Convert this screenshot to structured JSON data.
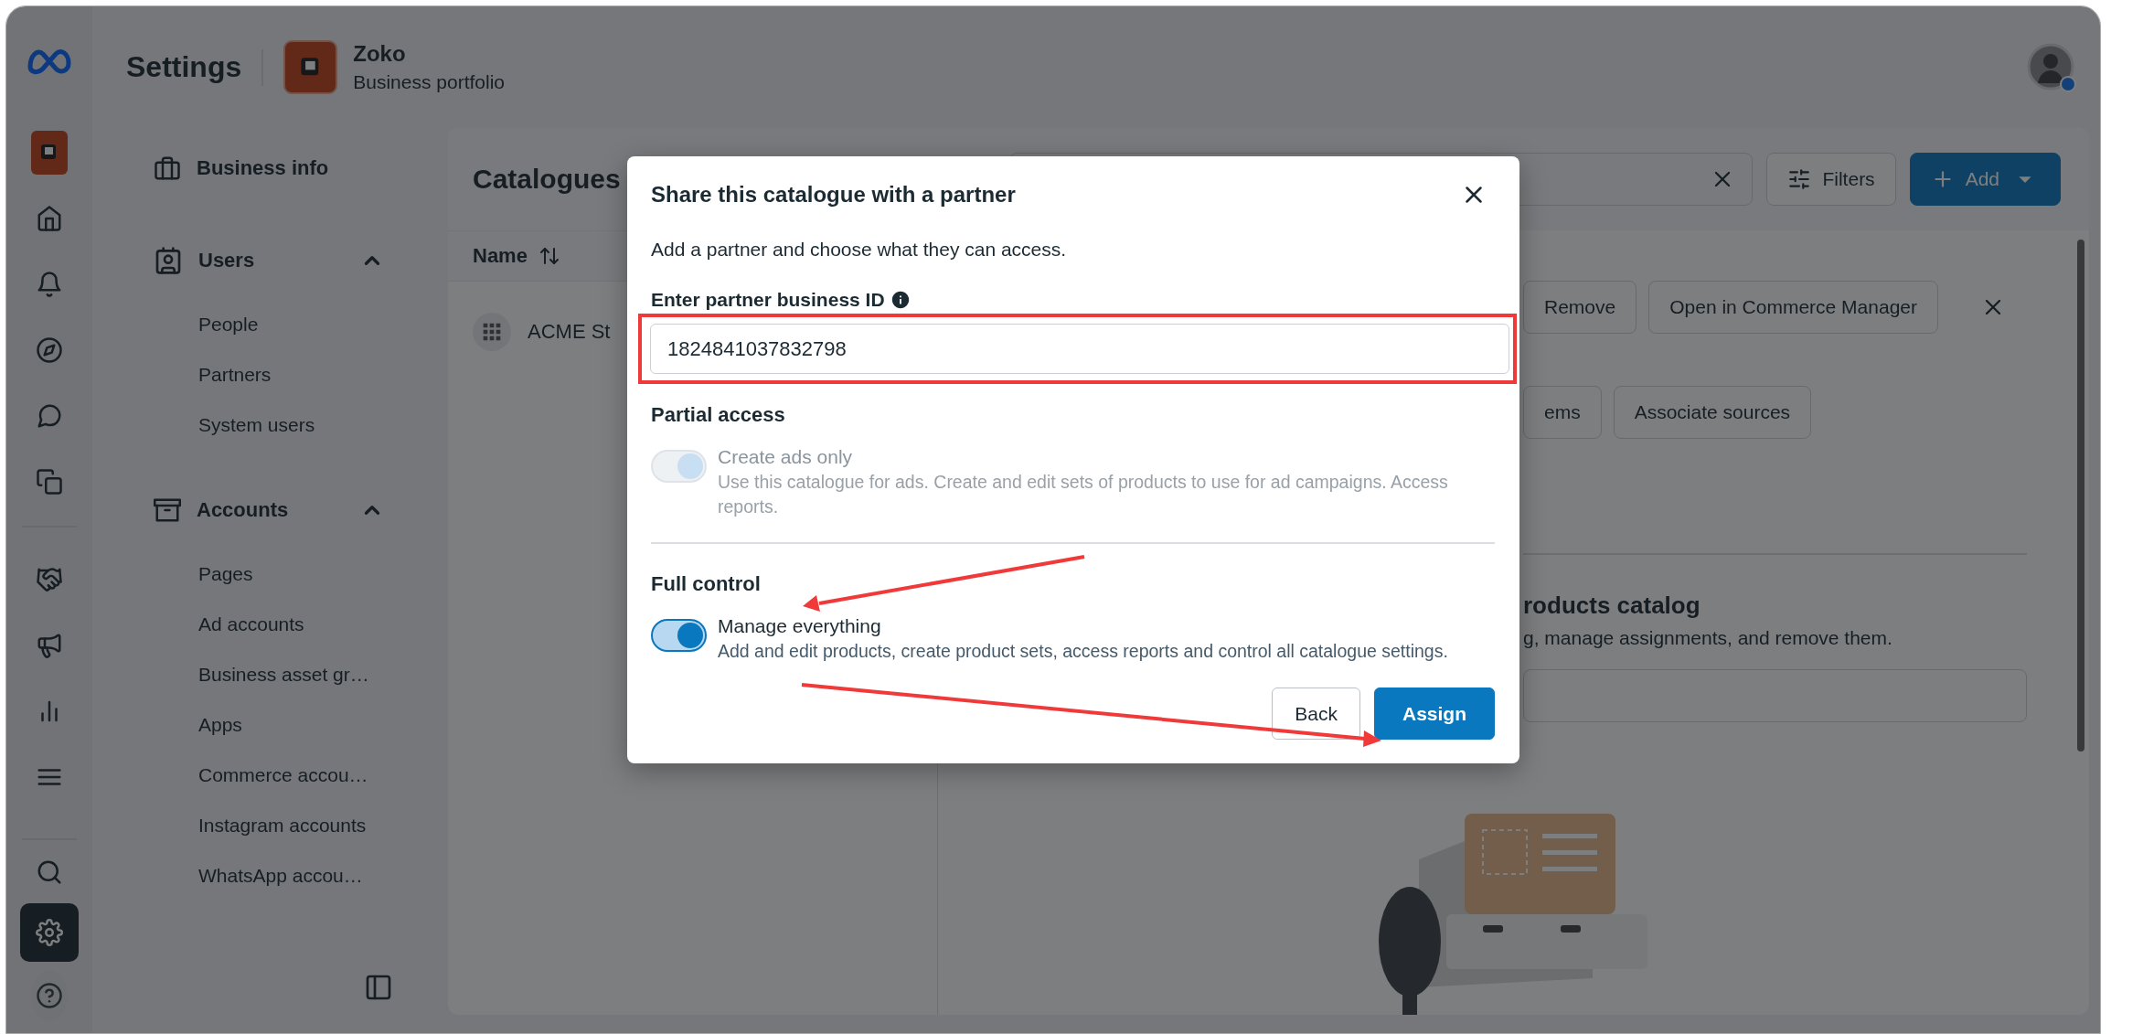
{
  "top_bar": {
    "title": "Settings",
    "portfolio": {
      "name": "Zoko",
      "subtitle": "Business portfolio"
    }
  },
  "rail": [
    {
      "kind": "portfolio",
      "selected": false
    },
    {
      "kind": "home",
      "selected": false
    },
    {
      "kind": "notifications",
      "selected": false
    },
    {
      "kind": "compass",
      "selected": false
    },
    {
      "kind": "chat",
      "selected": false
    },
    {
      "kind": "pages",
      "selected": false
    },
    {
      "kind": "divider"
    },
    {
      "kind": "partners",
      "selected": false
    },
    {
      "kind": "ads",
      "selected": false
    },
    {
      "kind": "insights",
      "selected": false
    },
    {
      "kind": "menu",
      "selected": false
    },
    {
      "kind": "divider"
    },
    {
      "kind": "search",
      "selected": false
    },
    {
      "kind": "settings",
      "selected": true
    },
    {
      "kind": "help",
      "selected": false
    }
  ],
  "sidebar": {
    "sections": [
      {
        "kind": "business",
        "label": "Business info"
      },
      {
        "kind": "users",
        "label": "Users",
        "expanded": true,
        "items": [
          "People",
          "Partners",
          "System users"
        ]
      },
      {
        "kind": "accounts",
        "label": "Accounts",
        "expanded": true,
        "items": [
          "Pages",
          "Ad accounts",
          "Business asset gr…",
          "Apps",
          "Commerce accou…",
          "Instagram accounts",
          "WhatsApp accou…"
        ]
      }
    ]
  },
  "catalogues": {
    "title": "Catalogues",
    "filters": "Filters",
    "add": "Add",
    "columns": [
      "Name"
    ],
    "rows": [
      "ACME St"
    ]
  },
  "detail": {
    "actions": [
      "Remove",
      "Open in Commerce Manager"
    ],
    "actions_2": [
      "ems",
      "Associate sources"
    ],
    "heading": "roducts catalog",
    "description": "g, manage assignments, and remove them."
  },
  "dialog": {
    "title": "Share this catalogue with a partner",
    "subtitle": "Add a partner and choose what they can access.",
    "field": {
      "label": "Enter partner business ID",
      "value": "1824841037832798"
    },
    "groups": [
      {
        "heading": "Partial access",
        "label": "Create ads only",
        "description": "Use this catalogue for ads. Create and edit sets of products to use for ad campaigns. Access reports.",
        "on": true,
        "disabled": true
      },
      {
        "heading": "Full control",
        "label": "Manage everything",
        "description": "Add and edit products, create product sets, access reports and control all catalogue settings.",
        "on": true,
        "disabled": false
      }
    ],
    "buttons": [
      {
        "label": "Back",
        "kind": "secondary"
      },
      {
        "label": "Assign",
        "kind": "primary"
      }
    ]
  }
}
